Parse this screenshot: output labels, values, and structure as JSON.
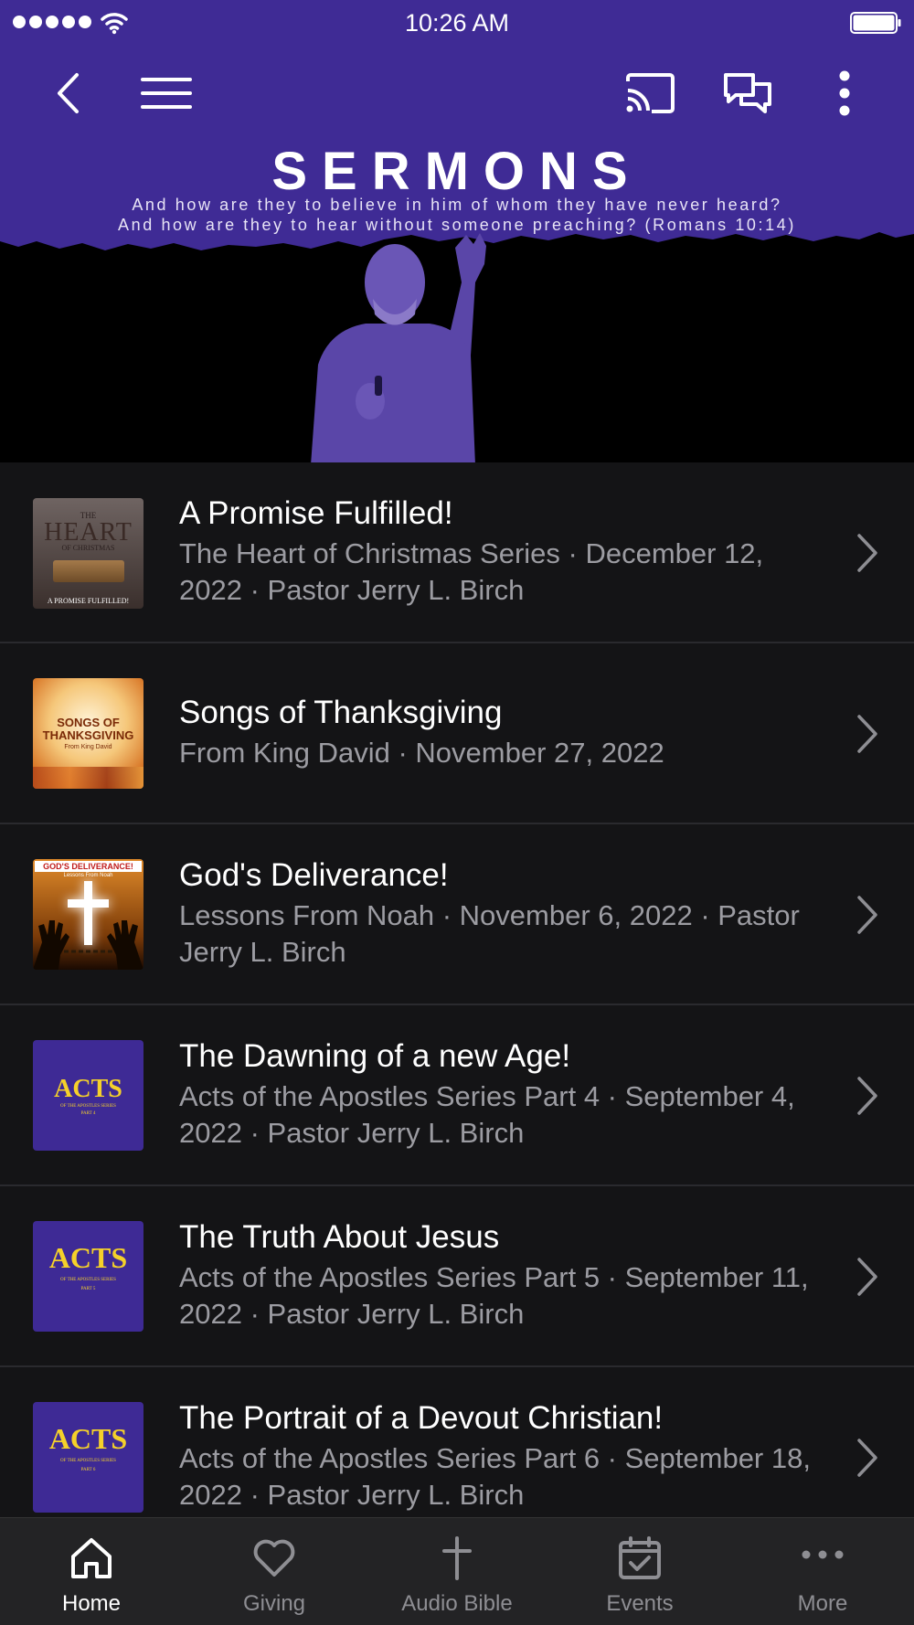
{
  "status_bar": {
    "time": "10:26 AM"
  },
  "colors": {
    "brand_purple": "#3f2b95",
    "background": "#141416",
    "tabbar_bg": "#232325",
    "acts_yellow": "#f5d12a"
  },
  "nav": {
    "icons": [
      "back-chevron-icon",
      "hamburger-menu-icon",
      "cast-icon",
      "chat-icon",
      "more-vertical-icon"
    ]
  },
  "banner": {
    "title": "SERMONS",
    "subtitle_line1": "And how are they to believe in him of whom they have never heard?",
    "subtitle_line2": "And how are they to hear without someone preaching? (Romans 10:14)"
  },
  "sermons": [
    {
      "title": "A Promise Fulfilled!",
      "subtitle": "The Heart of Christmas Series · December 12, 2022 · Pastor Jerry L. Birch",
      "thumb": {
        "small_top": "THE",
        "big": "HEART",
        "small_mid": "OF CHRISTMAS",
        "bottom": "A PROMISE FULFILLED!"
      }
    },
    {
      "title": "Songs of Thanksgiving",
      "subtitle": "From King David · November 27, 2022",
      "thumb": {
        "line1": "SONGS OF",
        "line2": "THANKSGIVING",
        "line3": "From King David"
      }
    },
    {
      "title": "God's Deliverance!",
      "subtitle": "Lessons From Noah · November 6, 2022 · Pastor Jerry L. Birch",
      "thumb": {
        "banner": "GOD'S DELIVERANCE!",
        "sub": "Lessons From Noah"
      }
    },
    {
      "title": "The Dawning of a new Age!",
      "subtitle": "Acts of the Apostles Series Part 4 · September 4, 2022 · Pastor Jerry L. Birch",
      "thumb": {
        "big": "ACTS",
        "sub": "OF THE APOSTLES SERIES",
        "part": "PART 4"
      }
    },
    {
      "title": "The Truth About Jesus",
      "subtitle": "Acts of the Apostles Series Part 5 · September 11, 2022 · Pastor Jerry L. Birch",
      "thumb": {
        "big": "ACTS",
        "sub": "OF THE APOSTLES SERIES",
        "part": "PART 5"
      }
    },
    {
      "title": "The Portrait of a Devout Christian!",
      "subtitle": "Acts of the Apostles Series Part 6 · September 18, 2022 · Pastor Jerry L. Birch",
      "thumb": {
        "big": "ACTS",
        "sub": "OF THE APOSTLES SERIES",
        "part": "PART 6"
      }
    }
  ],
  "tabs": [
    {
      "label": "Home",
      "icon": "home-icon",
      "active": true
    },
    {
      "label": "Giving",
      "icon": "heart-icon",
      "active": false
    },
    {
      "label": "Audio Bible",
      "icon": "cross-icon",
      "active": false
    },
    {
      "label": "Events",
      "icon": "calendar-check-icon",
      "active": false
    },
    {
      "label": "More",
      "icon": "more-horizontal-icon",
      "active": false
    }
  ]
}
